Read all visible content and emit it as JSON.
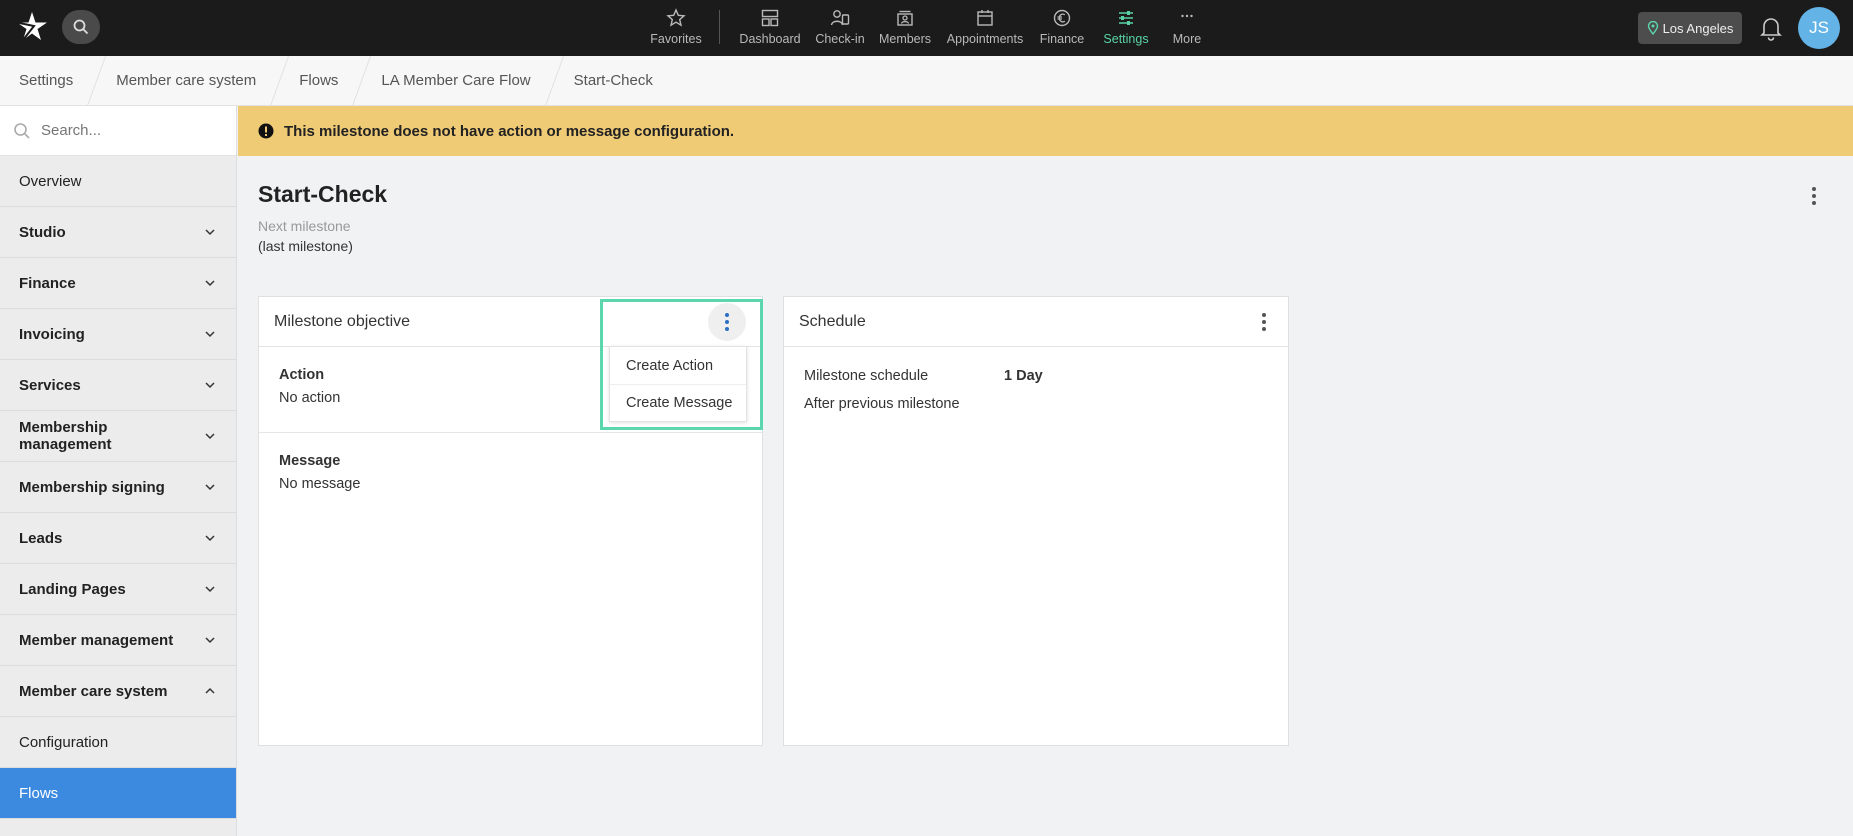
{
  "topbar": {
    "nav": [
      {
        "label": "Favorites",
        "icon": "star-icon"
      },
      {
        "label": "Dashboard",
        "icon": "dashboard-icon"
      },
      {
        "label": "Check-in",
        "icon": "checkin-icon"
      },
      {
        "label": "Members",
        "icon": "members-icon"
      },
      {
        "label": "Appointments",
        "icon": "calendar-icon"
      },
      {
        "label": "Finance",
        "icon": "euro-icon"
      },
      {
        "label": "Settings",
        "icon": "sliders-icon"
      },
      {
        "label": "More",
        "icon": "more-icon"
      }
    ],
    "active": "Settings",
    "location": "Los Angeles",
    "avatar_initials": "JS",
    "accent_color": "#59d3a5"
  },
  "breadcrumb": [
    "Settings",
    "Member care system",
    "Flows",
    "LA Member Care Flow",
    "Start-Check"
  ],
  "sidebar": {
    "search_placeholder": "Search...",
    "items": [
      {
        "label": "Overview"
      },
      {
        "label": "Studio"
      },
      {
        "label": "Finance"
      },
      {
        "label": "Invoicing"
      },
      {
        "label": "Services"
      },
      {
        "label": "Membership management"
      },
      {
        "label": "Membership signing"
      },
      {
        "label": "Leads"
      },
      {
        "label": "Landing Pages"
      },
      {
        "label": "Member management"
      },
      {
        "label": "Member care system"
      },
      {
        "label": "Configuration"
      },
      {
        "label": "Flows"
      }
    ]
  },
  "banner": {
    "text": "This milestone does not have action or message configuration.",
    "color": "#efcb76"
  },
  "page": {
    "title": "Start-Check",
    "next_label": "Next milestone",
    "next_value": "(last milestone)"
  },
  "objective_card": {
    "title": "Milestone objective",
    "action_label": "Action",
    "action_value": "No action",
    "message_label": "Message",
    "message_value": "No message",
    "menu": [
      "Create Action",
      "Create Message"
    ]
  },
  "schedule_card": {
    "title": "Schedule",
    "schedule_label": "Milestone schedule",
    "schedule_value": "1 Day",
    "after_text": "After previous milestone"
  }
}
